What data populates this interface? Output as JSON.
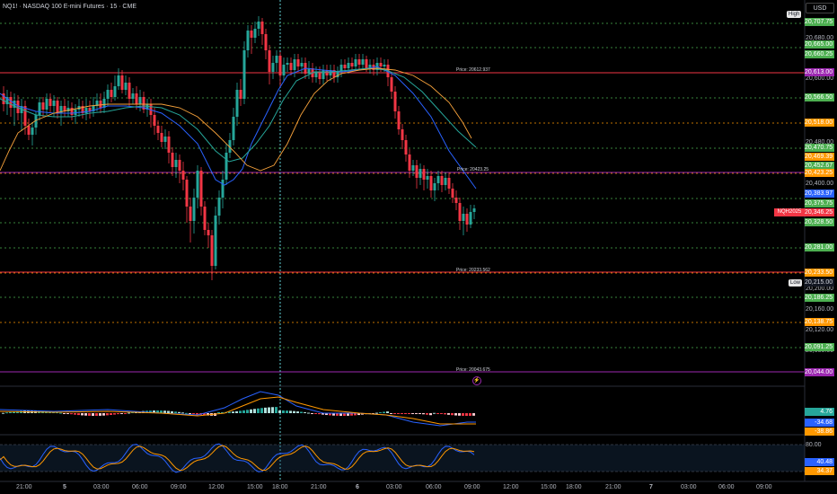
{
  "header": {
    "title": "NQ1! · NASDAQ 100 E-mini Futures · 15 · CME",
    "currency": "USD"
  },
  "tags": {
    "high": "High",
    "low": "Low",
    "symbol_marker": "NQH2025"
  },
  "price_axis": {
    "ticks": [
      "20,680.00",
      "20,600.00",
      "20,480.00",
      "20,400.00",
      "20,200.00",
      "20,160.00",
      "20,120.00",
      "20,080.00"
    ],
    "labels": [
      {
        "text": "20,707.75",
        "color": "#4caf50"
      },
      {
        "text": "20,665.00",
        "color": "#4caf50"
      },
      {
        "text": "20,660.25",
        "color": "#4caf50"
      },
      {
        "text": "20,613.00",
        "color": "#9c27b0"
      },
      {
        "text": "20,566.50",
        "color": "#4caf50"
      },
      {
        "text": "20,518.00",
        "color": "#ff9800"
      },
      {
        "text": "20,470.75",
        "color": "#4caf50"
      },
      {
        "text": "20,469.39",
        "color": "#ff9800"
      },
      {
        "text": "20,452.67",
        "color": "#4caf50"
      },
      {
        "text": "20,423.25",
        "color": "#ff9800"
      },
      {
        "text": "20,383.97",
        "color": "#2962ff"
      },
      {
        "text": "20,375.75",
        "color": "#4caf50"
      },
      {
        "text": "20,346.25",
        "color": "#f23645"
      },
      {
        "text": "20,328.50",
        "color": "#4caf50"
      },
      {
        "text": "20,281.00",
        "color": "#4caf50"
      },
      {
        "text": "20,233.50",
        "color": "#ff9800"
      },
      {
        "text": "20,215.00",
        "color": "#131722"
      },
      {
        "text": "20,186.25",
        "color": "#4caf50"
      },
      {
        "text": "20,138.75",
        "color": "#ff9800"
      },
      {
        "text": "20,091.25",
        "color": "#4caf50"
      },
      {
        "text": "20,044.00",
        "color": "#9c27b0"
      }
    ]
  },
  "price_notes": [
    "Price: 20612.937",
    "Price: 20423.25",
    "Price: 20233.562",
    "Price: 20043.675"
  ],
  "macd": {
    "labels": [
      {
        "text": "4.76",
        "color": "#26a69a"
      },
      {
        "text": "-34.68",
        "color": "#2962ff"
      },
      {
        "text": "-38.86",
        "color": "#ff9800"
      }
    ]
  },
  "stoch": {
    "tick": "80.00",
    "labels": [
      {
        "text": "40.48",
        "color": "#2962ff"
      },
      {
        "text": "34.37",
        "color": "#ff9800"
      }
    ]
  },
  "time_axis": [
    "21:00",
    "5",
    "03:00",
    "06:00",
    "09:00",
    "12:00",
    "15:00",
    "18:00",
    "21:00",
    "6",
    "03:00",
    "06:00",
    "09:00",
    "12:00",
    "15:00",
    "18:00",
    "21:00",
    "7",
    "03:00",
    "06:00",
    "09:00"
  ],
  "colors": {
    "up": "#26a69a",
    "down": "#f23645",
    "green_line": "#4caf50",
    "orange_line": "#ff9800",
    "purple_line": "#9c27b0",
    "ema_blue": "#2962ff",
    "ema_teal": "#26a69a",
    "ema_orange": "#f7a23b"
  }
}
